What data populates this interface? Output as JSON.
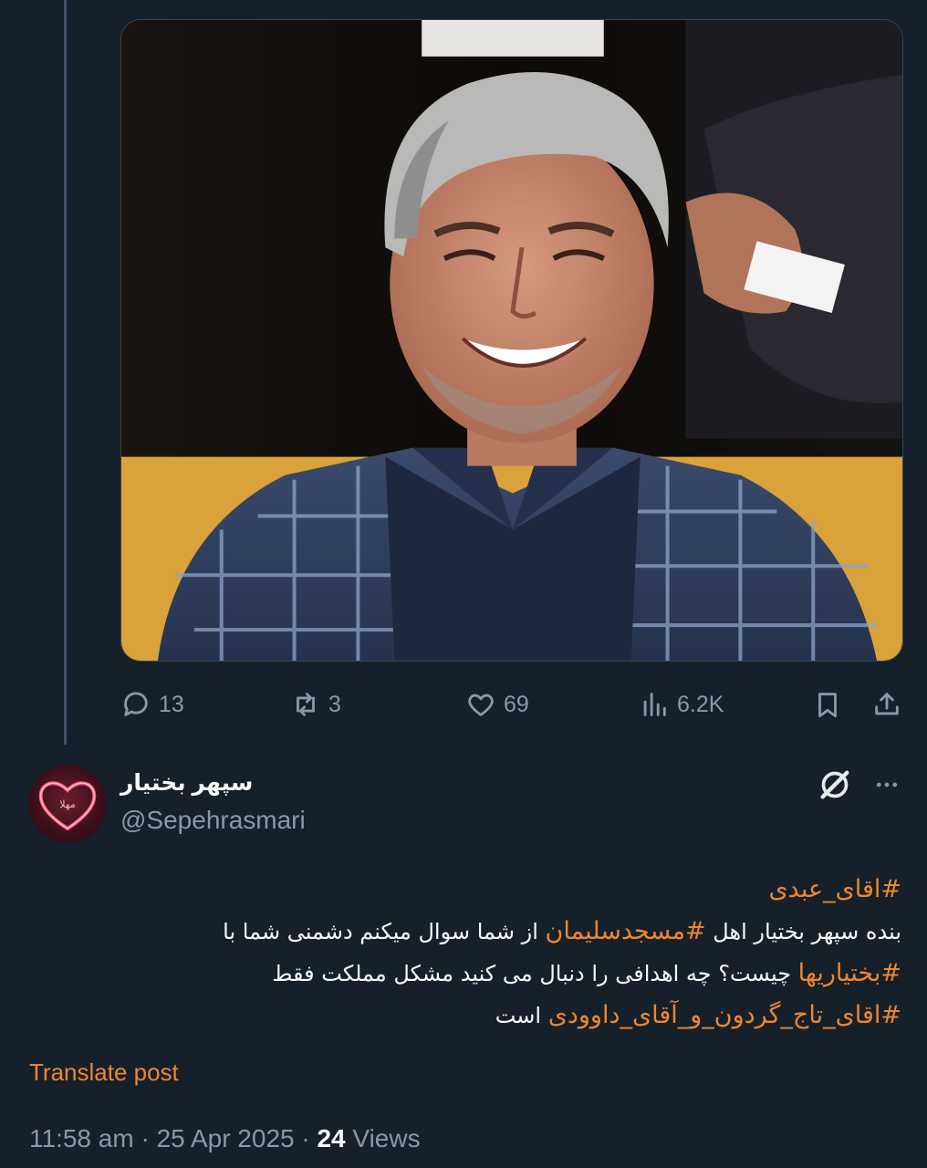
{
  "top_tweet": {
    "actions": {
      "replies": "13",
      "reposts": "3",
      "likes": "69",
      "views": "6.2K"
    }
  },
  "reply_tweet": {
    "author": {
      "display_name": "سپهر بختیار",
      "handle": "@Sepehrasmari",
      "avatar_text": "مهلا"
    },
    "text": {
      "line1": {
        "hashtag": "#اقای_عبدی"
      },
      "line2": {
        "pre": "بنده سپهر بختیار  اهل ",
        "hashtag": "#مسجدسلیمان",
        "post": " از شما سوال میکنم دشمنی شما با"
      },
      "line3": {
        "hashtag": "#بختیاریها",
        "post": " چیست؟ چه اهدافی را دنبال می کنید مشکل مملکت فقط"
      },
      "line4": {
        "hashtag": "#اقای_تاج_گردون_و_آقای_داوودی",
        "post": " است"
      }
    },
    "translate_label": "Translate post",
    "meta": {
      "time": "11:58 am",
      "sep1": " · ",
      "date": "25 Apr 2025",
      "sep2": " · ",
      "views_count": "24",
      "views_label": " Views"
    }
  },
  "colors": {
    "background": "#15202b",
    "accent": "#f0852d",
    "muted": "#8b98a5"
  },
  "icons": [
    "reply-icon",
    "repost-icon",
    "like-icon",
    "views-icon",
    "bookmark-icon",
    "share-icon",
    "grok-icon",
    "more-icon"
  ]
}
